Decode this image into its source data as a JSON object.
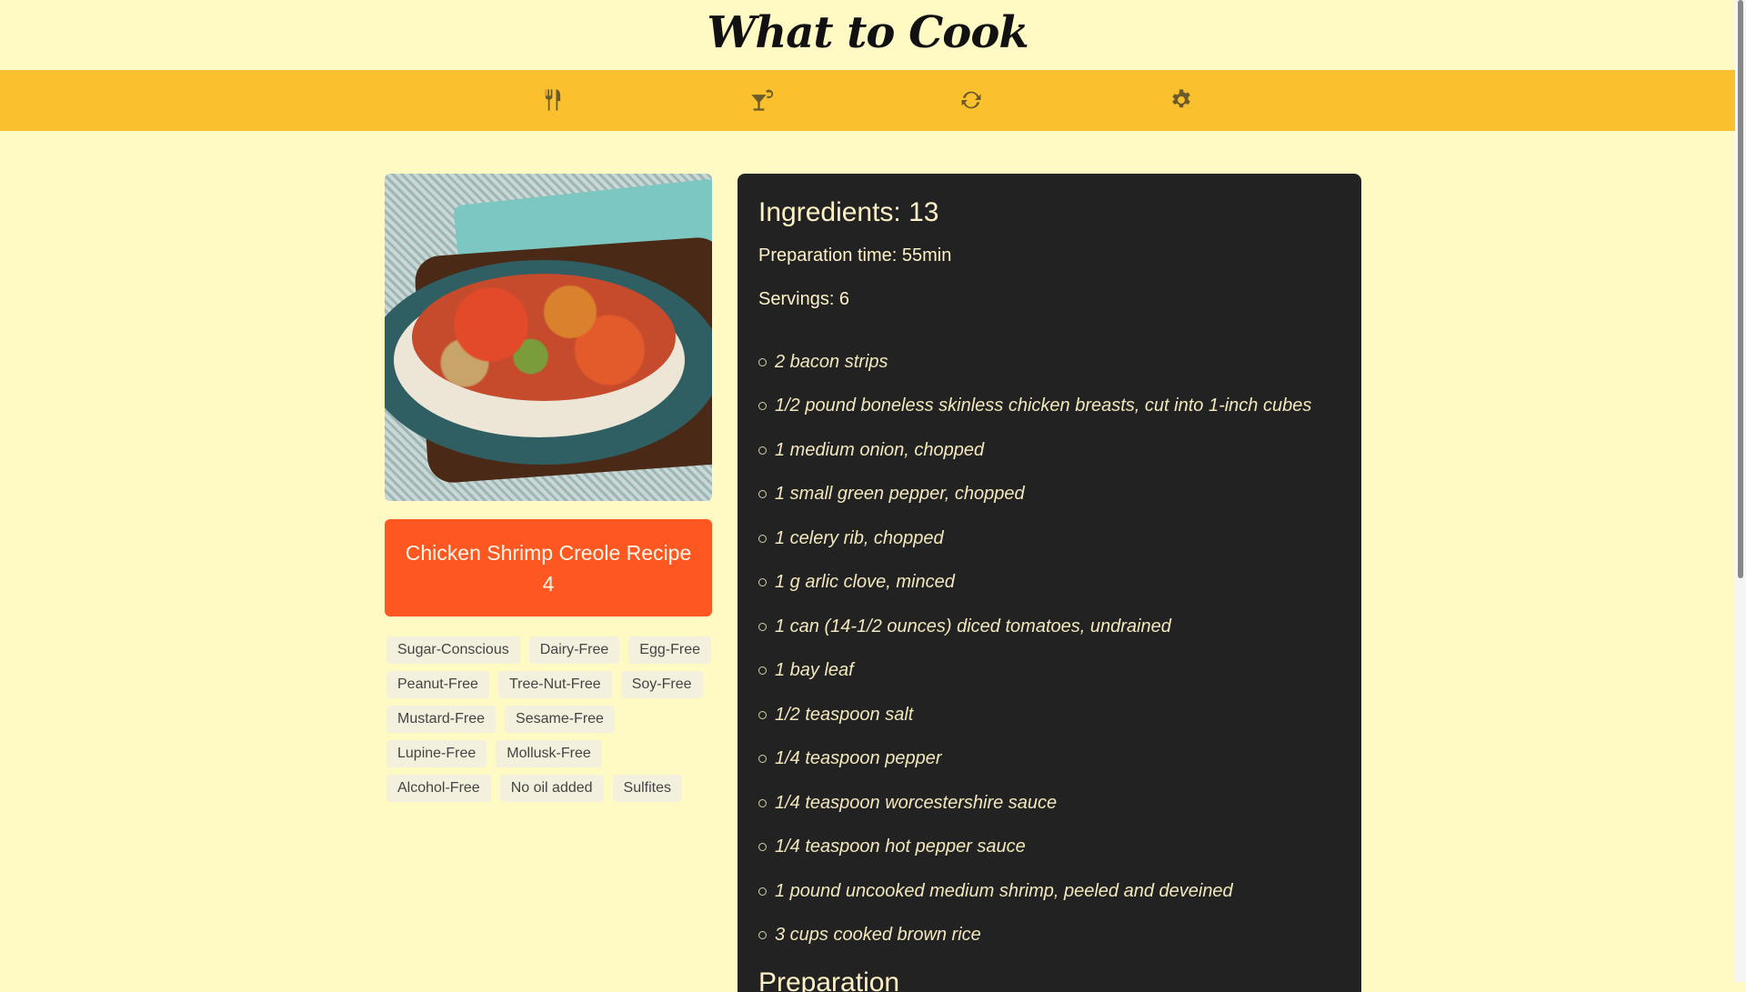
{
  "header": {
    "title": "What to Cook"
  },
  "nav": {
    "items": [
      {
        "icon": "fork-knife-icon"
      },
      {
        "icon": "cocktail-icon"
      },
      {
        "icon": "refresh-icon"
      },
      {
        "icon": "gear-icon"
      }
    ]
  },
  "recipe": {
    "title": "Chicken Shrimp Creole Recipe 4",
    "tags": [
      "Sugar-Conscious",
      "Dairy-Free",
      "Egg-Free",
      "Peanut-Free",
      "Tree-Nut-Free",
      "Soy-Free",
      "Mustard-Free",
      "Sesame-Free",
      "Lupine-Free",
      "Mollusk-Free",
      "Alcohol-Free",
      "No oil added",
      "Sulfites"
    ]
  },
  "details": {
    "ingredients_heading": "Ingredients: 13",
    "prep_time": "Preparation time: 55min",
    "servings": "Servings: 6",
    "ingredients": [
      "2 bacon strips",
      "1/2 pound boneless skinless chicken breasts, cut into 1-inch cubes",
      "1 medium onion, chopped",
      "1 small green pepper, chopped",
      "1 celery rib, chopped",
      "1 g arlic clove, minced",
      "1 can (14-1/2 ounces) diced tomatoes, undrained",
      "1 bay leaf",
      "1/2 teaspoon salt",
      "1/4 teaspoon pepper",
      "1/4 teaspoon worcestershire sauce",
      "1/4 teaspoon hot pepper sauce",
      "1 pound uncooked medium shrimp, peeled and deveined",
      "3 cups cooked brown rice"
    ],
    "preparation_heading": "Preparation"
  },
  "colors": {
    "background": "#fff9c4",
    "nav": "#fbc02d",
    "accent": "#ff5722",
    "panel": "#222222"
  }
}
